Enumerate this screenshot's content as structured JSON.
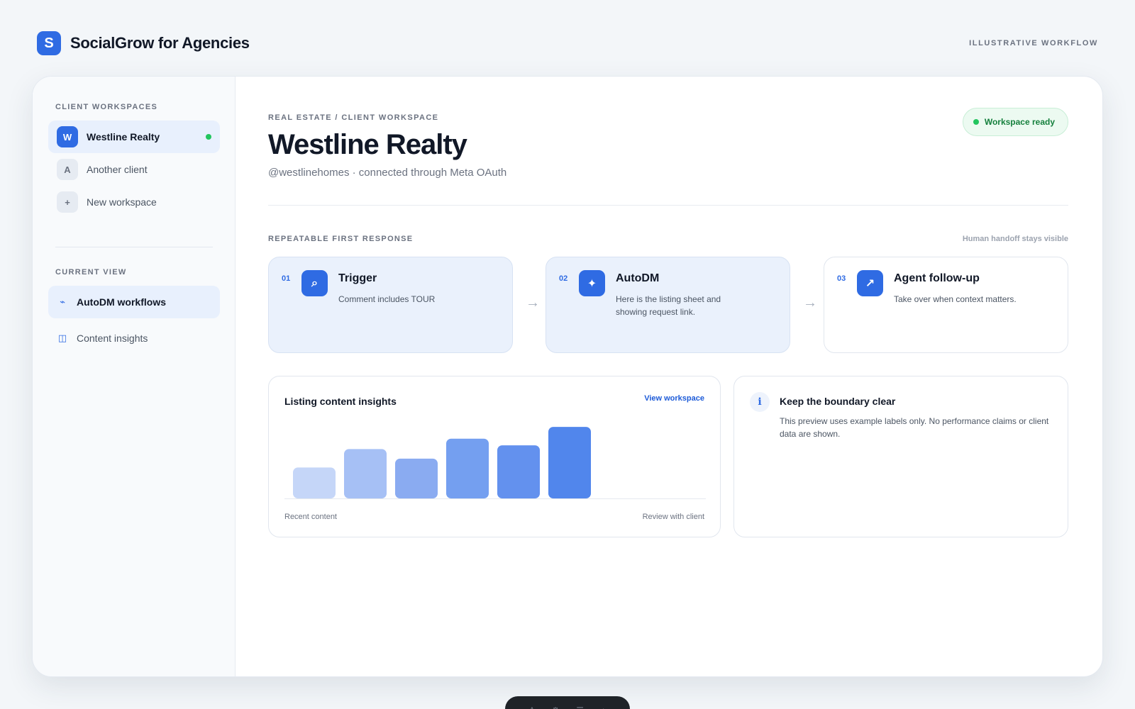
{
  "app": {
    "logo_letter": "S",
    "title": "SocialGrow for Agencies",
    "tag": "ILLUSTRATIVE WORKFLOW"
  },
  "sidebar": {
    "workspaces_label": "CLIENT WORKSPACES",
    "workspaces": [
      {
        "badge": "W",
        "label": "Westline Realty",
        "active": true
      },
      {
        "badge": "A",
        "label": "Another client"
      },
      {
        "badge": "+",
        "label": "New workspace"
      }
    ],
    "view_label": "CURRENT VIEW",
    "views": [
      {
        "icon": "⌁",
        "label": "AutoDM workflows",
        "active": true
      },
      {
        "icon": "◫",
        "label": "Content insights"
      }
    ]
  },
  "main": {
    "breadcrumb": "REAL ESTATE / CLIENT WORKSPACE",
    "title": "Westline Realty",
    "subtitle": "@westlinehomes · connected through Meta OAuth",
    "status": "Workspace ready",
    "section_label": "REPEATABLE FIRST RESPONSE",
    "section_note": "Human handoff stays visible",
    "steps": [
      {
        "num": "01",
        "icon": "⌕",
        "title": "Trigger",
        "desc": "Comment includes TOUR"
      },
      {
        "num": "02",
        "icon": "✦",
        "title": "AutoDM",
        "desc": "Here is the listing sheet and showing request link."
      },
      {
        "num": "03",
        "icon": "↗",
        "title": "Agent follow-up",
        "desc": "Take over when context matters."
      }
    ],
    "insights": {
      "title": "Listing content insights",
      "link": "View workspace",
      "footer_left": "Recent content",
      "footer_right": "Review with client"
    },
    "boundary": {
      "icon": "i",
      "title": "Keep the boundary clear",
      "text": "This preview uses example labels only. No performance claims or client data are shown."
    }
  },
  "chart_data": {
    "type": "bar",
    "values": [
      0.42,
      0.67,
      0.54,
      0.81,
      0.72,
      0.97
    ],
    "colors": [
      "#c5d6f8",
      "#a6c0f5",
      "#8aabf1",
      "#749ff0",
      "#6391ee",
      "#5186ec"
    ],
    "ylim": [
      0,
      1
    ]
  },
  "colors": {
    "accent": "#2f6be3",
    "ready": "#22c55e"
  },
  "dock": {
    "icons": [
      "A",
      "⚙",
      "☰",
      "⌂"
    ]
  }
}
